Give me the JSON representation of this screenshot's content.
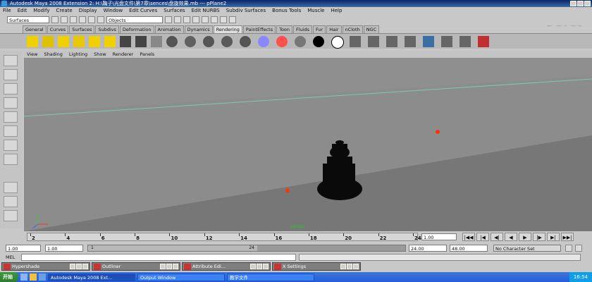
{
  "window": {
    "title": "Autodesk Maya 2008 Extension 2: H:\\鞠子\\光盘文件\\第7章\\sences\\盘旋效果.mb  ---  pPlane2",
    "watermark": "优酷"
  },
  "menubar": [
    "File",
    "Edit",
    "Modify",
    "Create",
    "Display",
    "Window",
    "Edit Curves",
    "Surfaces",
    "Edit NURBS",
    "Subdiv Surfaces",
    "Bonus Tools",
    "Muscle",
    "Help"
  ],
  "statusline": {
    "menuset": "Surfaces",
    "selection_mask": "Objects"
  },
  "shelf_tabs": [
    {
      "label": "General"
    },
    {
      "label": "Curves"
    },
    {
      "label": "Surfaces"
    },
    {
      "label": "Subdivs"
    },
    {
      "label": "Deformation"
    },
    {
      "label": "Animation"
    },
    {
      "label": "Dynamics"
    },
    {
      "label": "Rendering",
      "active": true
    },
    {
      "label": "PaintEffects"
    },
    {
      "label": "Toon"
    },
    {
      "label": "Fluids"
    },
    {
      "label": "Fur"
    },
    {
      "label": "Hair"
    },
    {
      "label": "nCloth"
    },
    {
      "label": "NGC"
    }
  ],
  "shelf_icons": [
    {
      "name": "ambient-light-icon",
      "color": "#f0d000"
    },
    {
      "name": "directional-light-icon",
      "color": "#e0c000"
    },
    {
      "name": "point-light-icon",
      "color": "#f0d000"
    },
    {
      "name": "spot-light-icon",
      "color": "#e8c800"
    },
    {
      "name": "area-light-icon",
      "color": "#f0d000"
    },
    {
      "name": "volume-light-icon",
      "color": "#f0d000"
    },
    {
      "name": "camera-icon",
      "color": "#444444"
    },
    {
      "name": "camera-aim-icon",
      "color": "#444444"
    },
    {
      "name": "render-view-icon",
      "color": "#888888"
    },
    {
      "name": "blinn-material-icon",
      "color": "#555555"
    },
    {
      "name": "lambert-material-icon",
      "color": "#606060"
    },
    {
      "name": "phong-material-icon",
      "color": "#555555"
    },
    {
      "name": "phonge-material-icon",
      "color": "#5a5a5a"
    },
    {
      "name": "anisotropic-material-icon",
      "color": "#555555"
    },
    {
      "name": "layered-shader-icon",
      "color": "#8888ff"
    },
    {
      "name": "ramp-shader-icon",
      "color": "#ff5050"
    },
    {
      "name": "surface-shader-icon",
      "color": "#777777"
    },
    {
      "name": "use-background-icon",
      "color": "#000000"
    },
    {
      "name": "shading-map-icon",
      "color": "#ffffff"
    },
    {
      "name": "hypershade-icon",
      "color": "#666666"
    },
    {
      "name": "render-globals-icon",
      "color": "#666666"
    },
    {
      "name": "ipr-render-icon",
      "color": "#666666"
    },
    {
      "name": "batch-render-icon",
      "color": "#666666"
    },
    {
      "name": "render-current-icon",
      "color": "#3a6ea5"
    },
    {
      "name": "render-region-icon",
      "color": "#666666"
    },
    {
      "name": "mental-ray-icon",
      "color": "#666666"
    },
    {
      "name": "paint-canvas-icon",
      "color": "#c03030"
    }
  ],
  "viewport": {
    "panel_menu": [
      "View",
      "Shading",
      "Lighting",
      "Show",
      "Renderer",
      "Panels"
    ],
    "camera_label": "persp1",
    "colors": {
      "floor": "#8c8c8c",
      "grid_line": "#7ec8b0",
      "pivot": "#ff3300",
      "model": "#0a0a0a"
    }
  },
  "timeline": {
    "tick_labels": [
      "2",
      "4",
      "6",
      "8",
      "10",
      "12",
      "14",
      "16",
      "18",
      "20",
      "22",
      "24"
    ],
    "current_frame": "1.00",
    "playback_controls": [
      "|◀◀",
      "|◀",
      "◀|",
      "◀",
      "▶",
      "|▶",
      "▶|",
      "▶▶|"
    ]
  },
  "range": {
    "start": "1.00",
    "playback_start": "1.00",
    "range_start_label": "1",
    "range_end_label": "24",
    "playback_end": "24.00",
    "end": "48.00",
    "character_set": "No Character Set"
  },
  "cmdline": {
    "label": "MEL"
  },
  "floating_windows": [
    {
      "title": "Hypershade"
    },
    {
      "title": "Outliner"
    },
    {
      "title": "Attribute Edi..."
    },
    {
      "title": "X Settings"
    }
  ],
  "taskbar": {
    "start": "开始",
    "tasks": [
      {
        "label": "Autodesk Maya 2008 Ext...",
        "active": true
      },
      {
        "label": "Output Window"
      },
      {
        "label": "教学文件"
      }
    ],
    "clock": "16:54"
  }
}
